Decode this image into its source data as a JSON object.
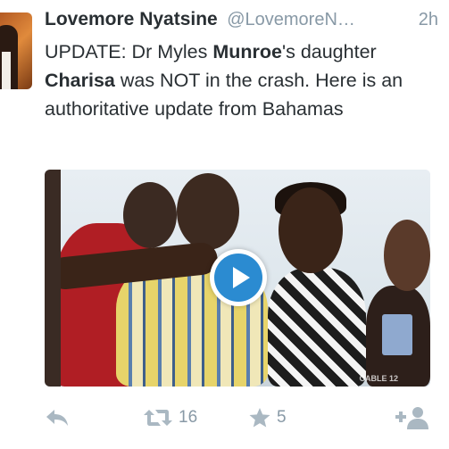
{
  "tweet": {
    "author_name": "Lovemore Nyatsine",
    "author_handle": "@LovemoreN…",
    "timestamp": "2h",
    "text_parts": [
      "UPDATE: Dr Myles ",
      "Munroe",
      "'s daughter ",
      "Charisa",
      " was NOT in the crash. Here is an authoritative update from Bahamas"
    ],
    "media": {
      "type": "video",
      "watermark": "CABLE 12"
    },
    "actions": {
      "reply_icon": "reply-icon",
      "retweet_icon": "retweet-icon",
      "retweet_count": "16",
      "favorite_icon": "star-icon",
      "favorite_count": "5",
      "follow_icon": "add-user-icon"
    }
  },
  "colors": {
    "text": "#292f33",
    "muted": "#8899a6",
    "icon": "#aab8c2",
    "play_blue": "#2b8bd1"
  }
}
